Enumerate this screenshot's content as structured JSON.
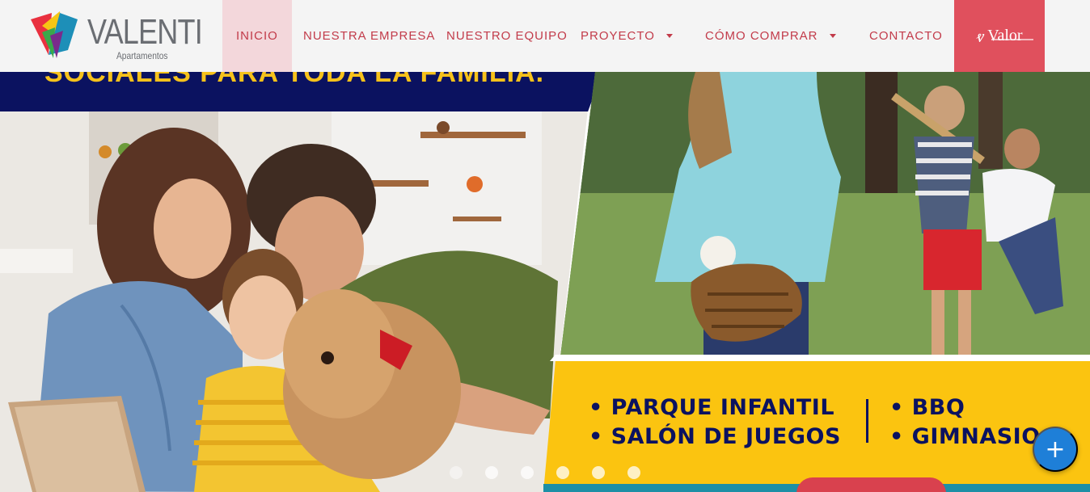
{
  "brand": {
    "name": "VALENTI",
    "subtitle": "Apartamentos"
  },
  "nav": {
    "items": [
      {
        "label": "INICIO"
      },
      {
        "label": "NUESTRA EMPRESA"
      },
      {
        "label": "NUESTRO EQUIPO"
      },
      {
        "label": "PROYECTO"
      },
      {
        "label": "CÓMO COMPRAR"
      },
      {
        "label": "CONTACTO"
      }
    ],
    "partner": {
      "label": "Valor",
      "icon": "valor-monogram-icon"
    }
  },
  "hero": {
    "headline_fragment": "SOCIALES PARA TODA LA FAMILIA.",
    "amenities": {
      "col1": [
        "• PARQUE INFANTIL",
        "• SALÓN DE JUEGOS"
      ],
      "col2": [
        "• BBQ",
        "• GIMNASIO"
      ]
    },
    "slide_count": 6,
    "active_slide": 1
  },
  "fab": {
    "label": "+",
    "icon": "plus-icon"
  },
  "colors": {
    "accent": "#c23b4a",
    "partner_bg": "#e0505d",
    "navy": "#0b1260",
    "yellow": "#fbc410",
    "fab": "#1e7fd8"
  }
}
